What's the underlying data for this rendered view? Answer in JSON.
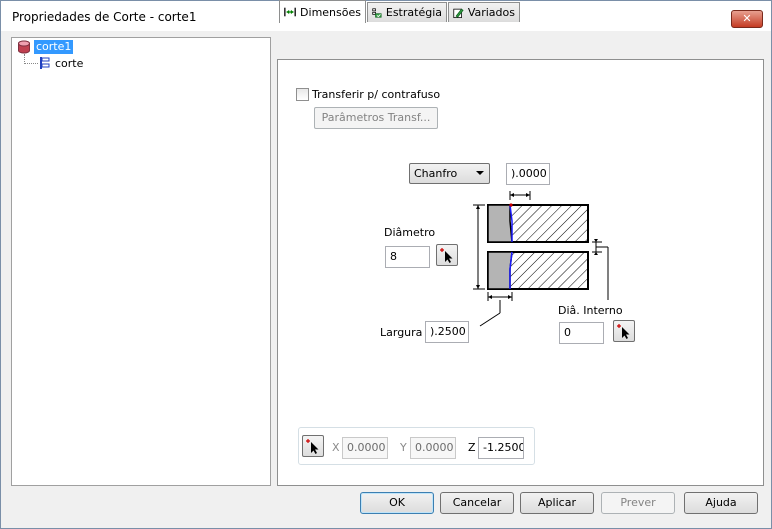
{
  "window": {
    "title": "Propriedades de Corte - corte1",
    "close_label": "✕"
  },
  "tree": {
    "root_label": "corte1",
    "child_label": "corte"
  },
  "tabs": [
    {
      "label": "Dimensões"
    },
    {
      "label": "Estratégia"
    },
    {
      "label": "Variados"
    }
  ],
  "dimensions": {
    "transfer_checkbox_label": "Transferir p/ contrafuso",
    "transfer_checked": false,
    "transfer_params_button": "Parâmetros Transf...",
    "edge_type_selected": "Chanfro",
    "chamfer_value": ").0000",
    "diameter_label": "Diâmetro",
    "diameter_value": "8",
    "width_label": "Largura",
    "width_value": ").2500",
    "inner_diameter_label": "Diâ. Interno",
    "inner_diameter_value": "0",
    "x_label": "X",
    "x_value": "0.0000",
    "y_label": "Y",
    "y_value": "0.0000",
    "z_label": "Z",
    "z_value": "-1.2500"
  },
  "buttons": {
    "ok": "OK",
    "cancel": "Cancelar",
    "apply": "Aplicar",
    "prev": "Prever",
    "help": "Ajuda"
  },
  "colors": {
    "selection": "#3399ff",
    "close_button": "#c43b23",
    "part_gray": "#b4b4b4",
    "pick_arrow": "#000000",
    "pick_marker": "#cc0000"
  }
}
